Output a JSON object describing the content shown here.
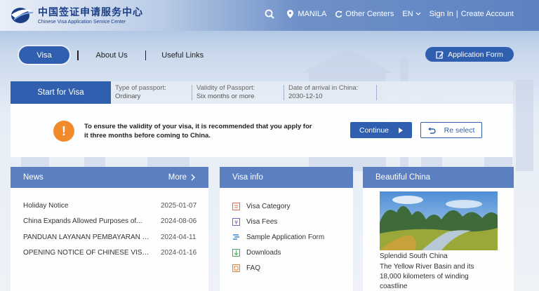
{
  "header": {
    "logo_cn": "中国签证申请服务中心",
    "logo_en": "Chinese Visa Application Service Center",
    "location": "MANILA",
    "other_centers": "Other Centers",
    "language": "EN",
    "sign_in": "Sign In",
    "separator": "|",
    "create_account": "Create Account"
  },
  "nav": {
    "visa": "Visa",
    "about": "About Us",
    "links": "Useful Links",
    "application_form": "Application Form"
  },
  "start": {
    "tab": "Start for Visa",
    "fields": [
      {
        "label": "Type of passport:",
        "value": "Ordinary"
      },
      {
        "label": "Validity of Passport:",
        "value": "Six months or more"
      },
      {
        "label": "Date of arrival in China:",
        "value": "2030-12-10"
      }
    ],
    "notice": "To ensure the validity of your visa, it is recommended that you apply for it three months before coming to China.",
    "continue": "Continue",
    "reselect": "Re select"
  },
  "news": {
    "title": "News",
    "more": "More",
    "items": [
      {
        "title": "Holiday Notice",
        "date": "2025-01-07"
      },
      {
        "title": "China Expands Allowed Purposes of...",
        "date": "2024-08-06"
      },
      {
        "title": "PANDUAN LAYANAN PEMBAYARAN DI...",
        "date": "2024-04-11"
      },
      {
        "title": "OPENING NOTICE OF CHINESE VISA...",
        "date": "2024-01-16"
      }
    ]
  },
  "visa_info": {
    "title": "Visa info",
    "items": [
      {
        "label": "Visa Category",
        "icon": "list-icon"
      },
      {
        "label": "Visa Fees",
        "icon": "fee-icon"
      },
      {
        "label": "Sample Application Form",
        "icon": "form-icon"
      },
      {
        "label": "Downloads",
        "icon": "download-icon"
      },
      {
        "label": "FAQ",
        "icon": "faq-icon"
      }
    ]
  },
  "beautiful": {
    "title": "Beautiful China",
    "caption_title": "Splendid South China",
    "caption_body": "The Yellow River Basin and its 18,000 kilometers of winding coastline"
  },
  "colors": {
    "primary": "#2f5fae",
    "header_card": "#5b7fc0",
    "warning": "#f08a2a"
  }
}
